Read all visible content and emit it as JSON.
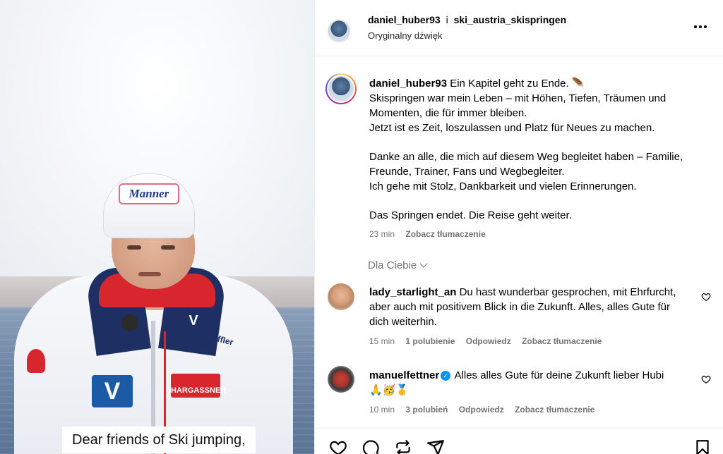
{
  "video": {
    "subtitle": "Dear friends of Ski jumping,",
    "beanie_logo": "Manner",
    "hargassner": "HARGASSNER",
    "loffler": "Löffler"
  },
  "header": {
    "username": "daniel_huber93",
    "separator": "i",
    "collab": "ski_austria_skispringen",
    "audio": "Oryginalny dźwięk",
    "more_icon": "more-horizontal-icon"
  },
  "caption": {
    "username": "daniel_huber93",
    "line1": "Ein Kapitel geht zu Ende. 🪶",
    "line2": "Skispringen war mein Leben – mit Höhen, Tiefen, Träumen und Momenten, die für immer bleiben.",
    "line3": "Jetzt ist es Zeit, loszulassen und Platz für Neues zu machen.",
    "line4": "Danke an alle, die mich auf diesem Weg begleitet haben – Familie, Freunde, Trainer, Fans und Wegbegleiter.",
    "line5": "Ich gehe mit Stolz, Dankbarkeit und vielen Erinnerungen.",
    "line6": "Das Springen endet. Die Reise geht weiter.",
    "time": "23 min",
    "translate": "Zobacz tłumaczenie"
  },
  "filter": {
    "label": "Dla Ciebie"
  },
  "comments": [
    {
      "username": "lady_starlight_an",
      "text": "Du hast wunderbar gesprochen, mit Ehrfurcht, aber auch mit positivem Blick in die Zukunft. Alles, alles Gute für dich weiterhin.",
      "time": "15 min",
      "likes": "1 polubienie",
      "reply": "Odpowiedz",
      "translate": "Zobacz tłumaczenie"
    },
    {
      "username": "manuelfettner",
      "verified": true,
      "text": "Alles alles Gute für deine Zukunft lieber Hubi 🙏🥳🥇",
      "time": "10 min",
      "likes": "3 polubień",
      "reply": "Odpowiedz",
      "translate": "Zobacz tłumaczenie"
    }
  ],
  "actions": [
    "heart-icon",
    "comment-icon",
    "share-icon",
    "send-icon",
    "bookmark-icon"
  ]
}
